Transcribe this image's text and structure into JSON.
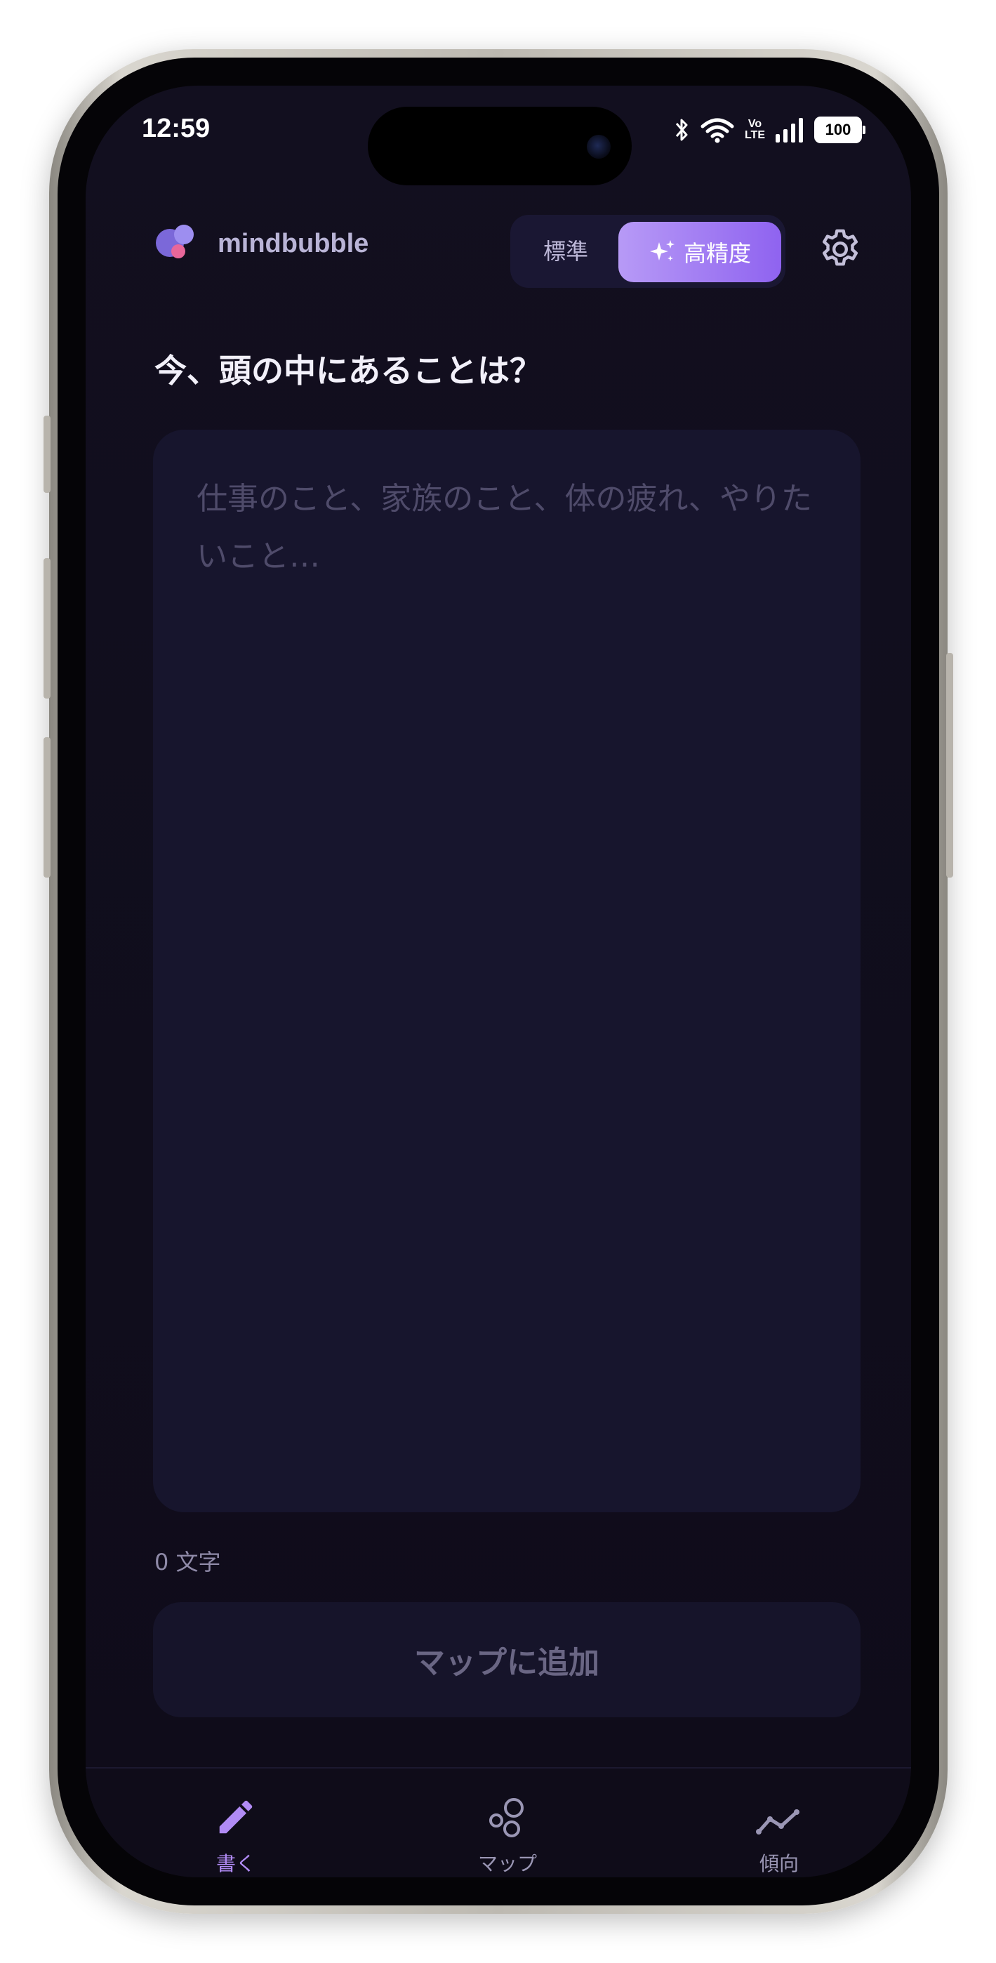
{
  "status_bar": {
    "time": "12:59",
    "lte_label_top": "Vo",
    "lte_label_bottom": "LTE",
    "battery": "100"
  },
  "header": {
    "app_name": "mindbubble",
    "mode_standard": "標準",
    "mode_high_precision": "高精度",
    "selected_mode": "高精度"
  },
  "editor": {
    "prompt": "今、頭の中にあることは？",
    "placeholder": "仕事のこと、家族のこと、体の疲れ、やりたいこと…",
    "value": "",
    "char_count": "0 文字"
  },
  "actions": {
    "add_to_map": "マップに追加"
  },
  "bottom_nav": {
    "items": [
      {
        "label": "書く",
        "icon": "pencil-icon",
        "active": true
      },
      {
        "label": "マップ",
        "icon": "bubbles-icon",
        "active": false
      },
      {
        "label": "傾向",
        "icon": "trend-icon",
        "active": false
      }
    ]
  },
  "colors": {
    "background": "#110e1e",
    "accent": "#9d6cf2",
    "card": "#17152d",
    "inactive_text": "#9a96b4"
  }
}
